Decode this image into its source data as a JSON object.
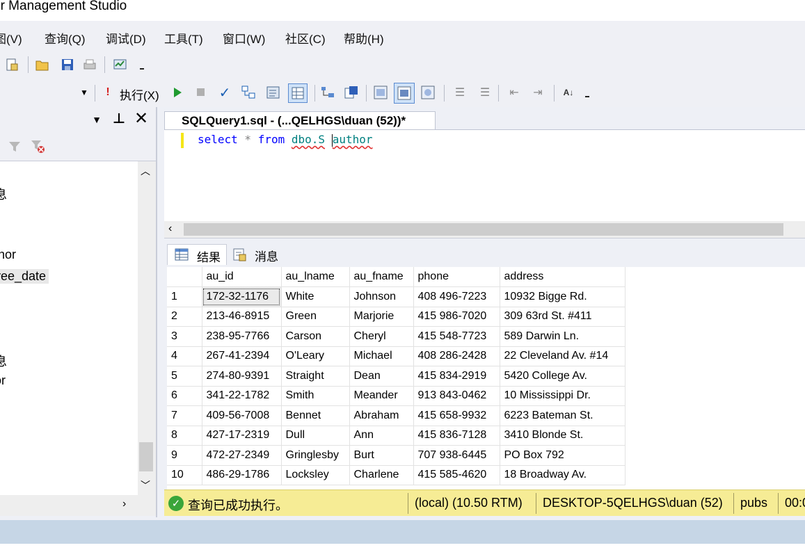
{
  "window": {
    "title": "er Management Studio"
  },
  "menu": [
    {
      "label": "图(V)"
    },
    {
      "label": "查询(Q)"
    },
    {
      "label": "调试(D)"
    },
    {
      "label": "工具(T)"
    },
    {
      "label": "窗口(W)"
    },
    {
      "label": "社区(C)"
    },
    {
      "label": "帮助(H)"
    }
  ],
  "toolbar": {
    "execute_label": "执行(X)",
    "icons": [
      "new-query-icon",
      "open-file-icon",
      "save-icon",
      "print-icon",
      "activity-monitor-icon",
      "execute-icon",
      "debug-run-icon",
      "stop-icon",
      "parse-check-icon",
      "query-designer-icon",
      "results-to-text-icon",
      "results-to-grid-icon",
      "execution-plan-icon",
      "comment-icon",
      "uncomment-icon",
      "outdent-icon",
      "indent-icon",
      "specify-values-icon"
    ]
  },
  "object_explorer": {
    "tree_fragments": [
      "息",
      "thor",
      "yee_date",
      "息",
      "or",
      "r"
    ]
  },
  "document_tab": {
    "title": "SQLQuery1.sql - (...QELHGS\\duan (52))*"
  },
  "editor": {
    "kw_select": "select",
    "star": " * ",
    "kw_from": "from",
    "ident_a": "dbo.S",
    "ident_b": "author"
  },
  "results_tabs": [
    {
      "label": "结果"
    },
    {
      "label": "消息"
    }
  ],
  "results": {
    "columns": [
      "",
      "au_id",
      "au_lname",
      "au_fname",
      "phone",
      "address"
    ],
    "rows": [
      [
        "1",
        "172-32-1176",
        "White",
        "Johnson",
        "408 496-7223",
        "10932 Bigge Rd."
      ],
      [
        "2",
        "213-46-8915",
        "Green",
        "Marjorie",
        "415 986-7020",
        "309 63rd St. #411"
      ],
      [
        "3",
        "238-95-7766",
        "Carson",
        "Cheryl",
        "415 548-7723",
        "589 Darwin Ln."
      ],
      [
        "4",
        "267-41-2394",
        "O'Leary",
        "Michael",
        "408 286-2428",
        "22 Cleveland Av. #14"
      ],
      [
        "5",
        "274-80-9391",
        "Straight",
        "Dean",
        "415 834-2919",
        "5420 College Av."
      ],
      [
        "6",
        "341-22-1782",
        "Smith",
        "Meander",
        "913 843-0462",
        "10 Mississippi Dr."
      ],
      [
        "7",
        "409-56-7008",
        "Bennet",
        "Abraham",
        "415 658-9932",
        "6223 Bateman St."
      ],
      [
        "8",
        "427-17-2319",
        "Dull",
        "Ann",
        "415 836-7128",
        "3410 Blonde St."
      ],
      [
        "9",
        "472-27-2349",
        "Gringlesby",
        "Burt",
        "707 938-6445",
        "PO Box 792"
      ],
      [
        "10",
        "486-29-1786",
        "Locksley",
        "Charlene",
        "415 585-4620",
        "18 Broadway Av."
      ]
    ]
  },
  "status": {
    "message": "查询已成功执行。",
    "server": "(local) (10.50 RTM)",
    "user": "DESKTOP-5QELHGS\\duan (52)",
    "database": "pubs",
    "time": "00:0"
  },
  "colors": {
    "status_bg": "#f6ec95",
    "keyword": "#0000ff",
    "identifier": "#008080",
    "ok": "#3aa53a"
  }
}
